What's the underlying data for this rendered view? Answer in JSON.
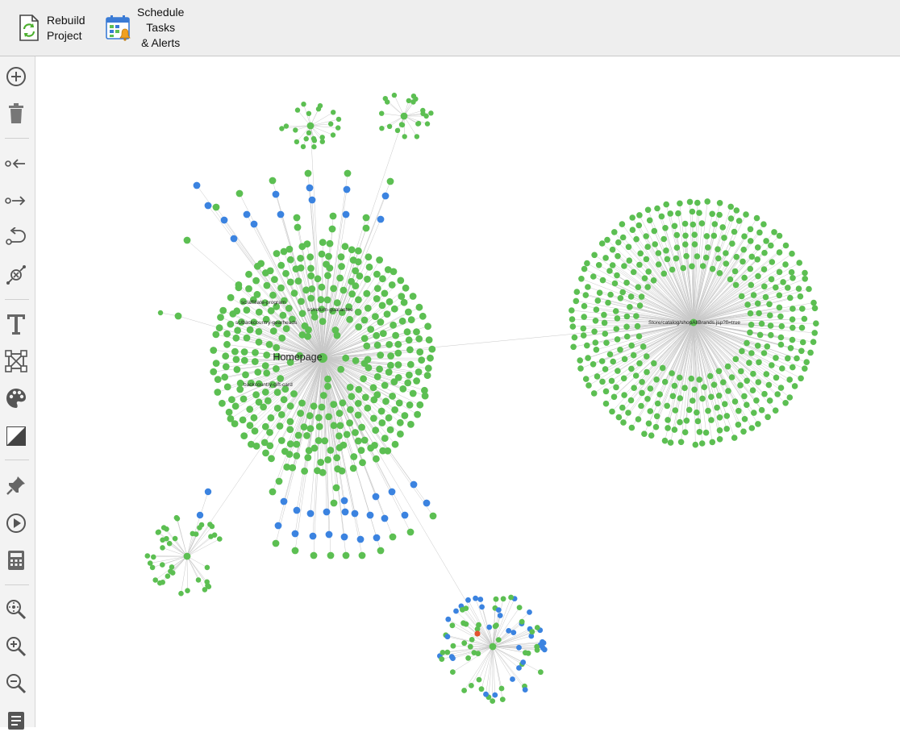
{
  "toolbar": {
    "rebuild_line1": "Rebuild",
    "rebuild_line2": "Project",
    "schedule_line1": "Schedule",
    "schedule_line2": "Tasks",
    "schedule_line3": "& Alerts"
  },
  "sidebar": {
    "tools": [
      {
        "name": "add-node-icon",
        "title": "Add"
      },
      {
        "name": "delete-icon",
        "title": "Delete"
      },
      {
        "name": "incoming-links-icon",
        "title": "Incoming links"
      },
      {
        "name": "outgoing-links-icon",
        "title": "Outgoing links"
      },
      {
        "name": "return-links-icon",
        "title": "Return links"
      },
      {
        "name": "broken-link-icon",
        "title": "Broken links"
      },
      {
        "name": "text-icon",
        "title": "Text"
      },
      {
        "name": "layout-icon",
        "title": "Layout"
      },
      {
        "name": "palette-icon",
        "title": "Colors"
      },
      {
        "name": "contrast-icon",
        "title": "Contrast"
      },
      {
        "name": "pin-icon",
        "title": "Pin"
      },
      {
        "name": "play-icon",
        "title": "Play"
      },
      {
        "name": "calculator-icon",
        "title": "Calculator"
      },
      {
        "name": "zoom-fit-icon",
        "title": "Zoom to fit"
      },
      {
        "name": "zoom-in-icon",
        "title": "Zoom in"
      },
      {
        "name": "zoom-out-icon",
        "title": "Zoom out"
      },
      {
        "name": "list-icon",
        "title": "List"
      }
    ]
  },
  "colors": {
    "node_green": "#5cbf52",
    "node_blue": "#3b83e0",
    "node_red": "#e2532f",
    "edge": "#c8c8c8",
    "toolbar_bg": "#eeeeee",
    "sidebar_icon": "#555555"
  },
  "graph": {
    "labels": {
      "homepage": "Homepage",
      "affiliate": "sc/affiliate-program",
      "guarantee": "sc/return-guarantee",
      "gearheads": "sc/backcountry-gearheads",
      "giftcard": "backcountry-gift-card",
      "brands": "Store/catalog/shopAllBrands.jsp?fl=true"
    }
  }
}
